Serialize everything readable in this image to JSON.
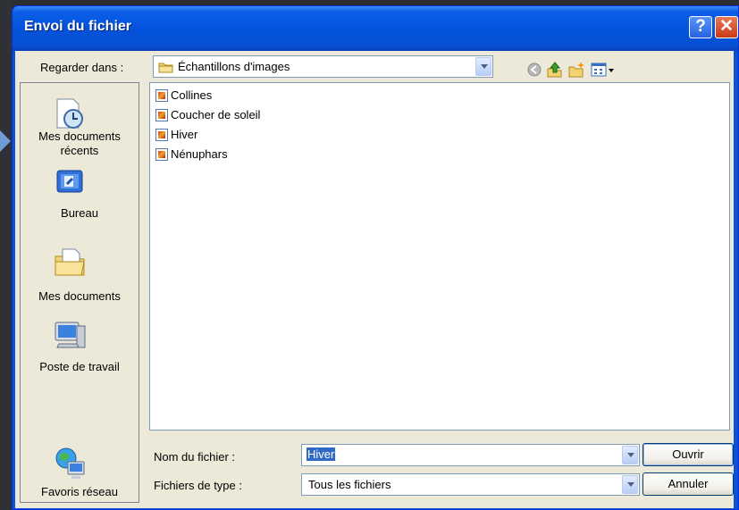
{
  "dialog": {
    "title": "Envoi du fichier",
    "help_glyph": "?",
    "close_glyph": "✕"
  },
  "look_in": {
    "label": "Regarder dans :",
    "value": "Échantillons d'images"
  },
  "places": [
    {
      "label_line1": "Mes documents",
      "label_line2": "récents",
      "icon": "recent-documents-icon"
    },
    {
      "label_line1": "Bureau",
      "label_line2": "",
      "icon": "desktop-icon"
    },
    {
      "label_line1": "Mes documents",
      "label_line2": "",
      "icon": "my-documents-icon"
    },
    {
      "label_line1": "Poste de travail",
      "label_line2": "",
      "icon": "my-computer-icon"
    },
    {
      "label_line1": "Favoris réseau",
      "label_line2": "",
      "icon": "network-places-icon"
    }
  ],
  "files": [
    {
      "name": "Collines"
    },
    {
      "name": "Coucher de soleil"
    },
    {
      "name": "Hiver"
    },
    {
      "name": "Nénuphars"
    }
  ],
  "filename": {
    "label": "Nom du fichier :",
    "value": "Hiver"
  },
  "filetype": {
    "label": "Fichiers de type :",
    "value": "Tous les fichiers"
  },
  "buttons": {
    "open": "Ouvrir",
    "cancel": "Annuler"
  },
  "colors": {
    "titlebar": "#0453dc",
    "client": "#ece9d8",
    "selection": "#316ac5"
  }
}
